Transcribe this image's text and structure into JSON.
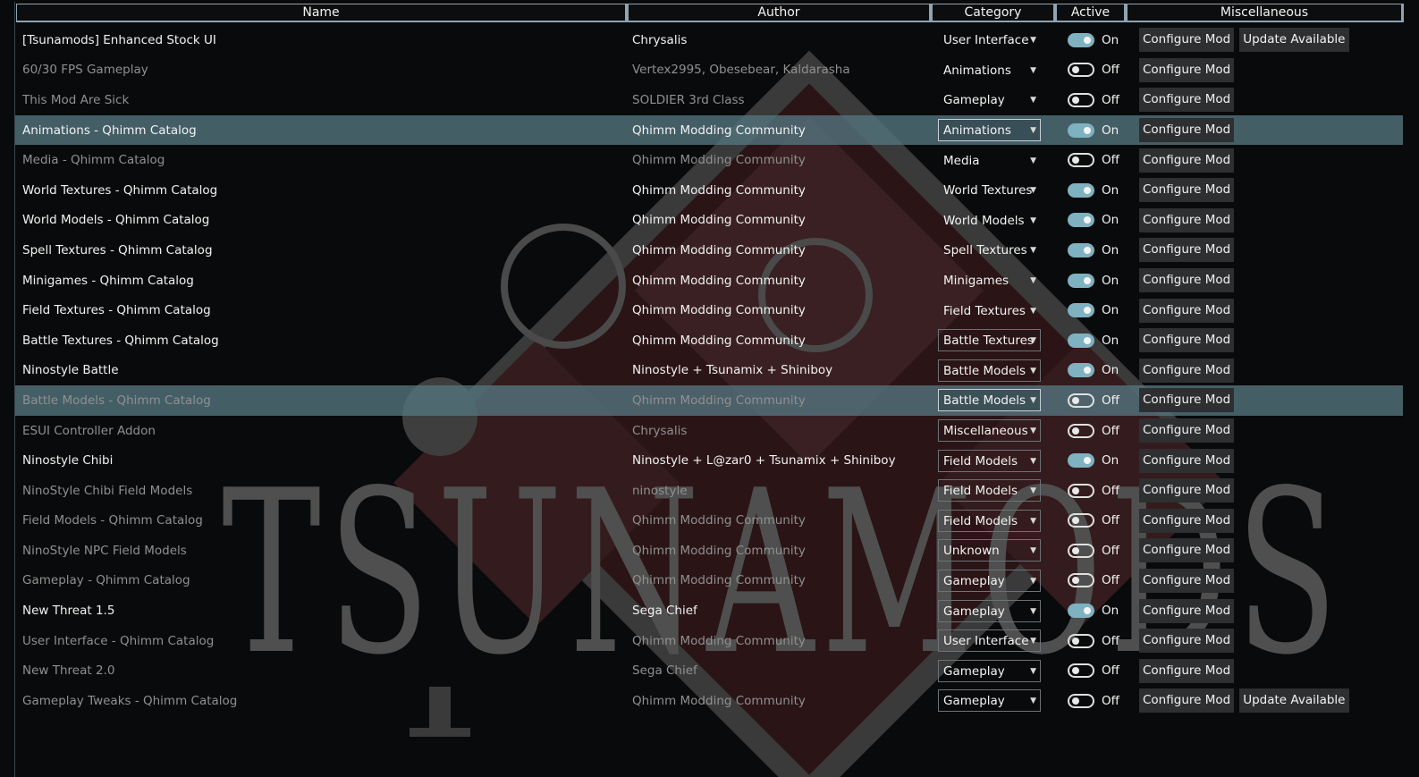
{
  "columns": {
    "name": "Name",
    "author": "Author",
    "category": "Category",
    "active": "Active",
    "misc": "Miscellaneous"
  },
  "watermark_text": "TSUNAMODS",
  "configure_label": "Configure Mod",
  "mods": [
    {
      "name": "[Tsunamods] Enhanced Stock UI",
      "author": "Chrysalis",
      "category": "User Interface",
      "active": "On",
      "update": "Update Available"
    },
    {
      "name": "60/30 FPS Gameplay",
      "author": "Vertex2995, Obesebear, Kaldarasha",
      "category": "Animations",
      "active": "Off"
    },
    {
      "name": "This Mod Are Sick",
      "author": "SOLDIER 3rd Class",
      "category": "Gameplay",
      "active": "Off"
    },
    {
      "name": "Animations - Qhimm Catalog",
      "author": "Qhimm Modding Community",
      "category": "Animations",
      "active": "On"
    },
    {
      "name": "Media - Qhimm Catalog",
      "author": "Qhimm Modding Community",
      "category": "Media",
      "active": "Off"
    },
    {
      "name": "World Textures - Qhimm Catalog",
      "author": "Qhimm Modding Community",
      "category": "World Textures",
      "active": "On"
    },
    {
      "name": "World Models - Qhimm Catalog",
      "author": "Qhimm Modding Community",
      "category": "World Models",
      "active": "On"
    },
    {
      "name": "Spell Textures - Qhimm Catalog",
      "author": "Qhimm Modding Community",
      "category": "Spell Textures",
      "active": "On"
    },
    {
      "name": "Minigames - Qhimm Catalog",
      "author": "Qhimm Modding Community",
      "category": "Minigames",
      "active": "On"
    },
    {
      "name": "Field Textures - Qhimm Catalog",
      "author": "Qhimm Modding Community",
      "category": "Field Textures",
      "active": "On"
    },
    {
      "name": "Battle Textures - Qhimm Catalog",
      "author": "Qhimm Modding Community",
      "category": "Battle Textures",
      "active": "On"
    },
    {
      "name": "Ninostyle Battle",
      "author": "Ninostyle + Tsunamix + Shiniboy",
      "category": "Battle Models",
      "active": "On"
    },
    {
      "name": "Battle Models - Qhimm Catalog",
      "author": "Qhimm Modding Community",
      "category": "Battle Models",
      "active": "Off"
    },
    {
      "name": "ESUI Controller Addon",
      "author": "Chrysalis",
      "category": "Miscellaneous",
      "active": "Off"
    },
    {
      "name": "Ninostyle Chibi",
      "author": "Ninostyle + L@zar0 + Tsunamix + Shiniboy",
      "category": "Field Models",
      "active": "On"
    },
    {
      "name": "NinoStyle Chibi Field Models",
      "author": "ninostyle",
      "category": "Field Models",
      "active": "Off"
    },
    {
      "name": "Field Models - Qhimm Catalog",
      "author": "Qhimm Modding Community",
      "category": "Field Models",
      "active": "Off"
    },
    {
      "name": "NinoStyle NPC Field Models",
      "author": "Qhimm Modding Community",
      "category": "Unknown",
      "active": "Off"
    },
    {
      "name": "Gameplay - Qhimm Catalog",
      "author": "Qhimm Modding Community",
      "category": "Gameplay",
      "active": "Off"
    },
    {
      "name": "New Threat 1.5",
      "author": "Sega Chief",
      "category": "Gameplay",
      "active": "On"
    },
    {
      "name": "User Interface - Qhimm Catalog",
      "author": "Qhimm Modding Community",
      "category": "User Interface",
      "active": "Off"
    },
    {
      "name": "New Threat 2.0",
      "author": "Sega Chief",
      "category": "Gameplay",
      "active": "Off"
    },
    {
      "name": "Gameplay Tweaks - Qhimm Catalog",
      "author": "Qhimm Modding Community",
      "category": "Gameplay",
      "active": "Off",
      "update": "Update Available"
    }
  ]
}
